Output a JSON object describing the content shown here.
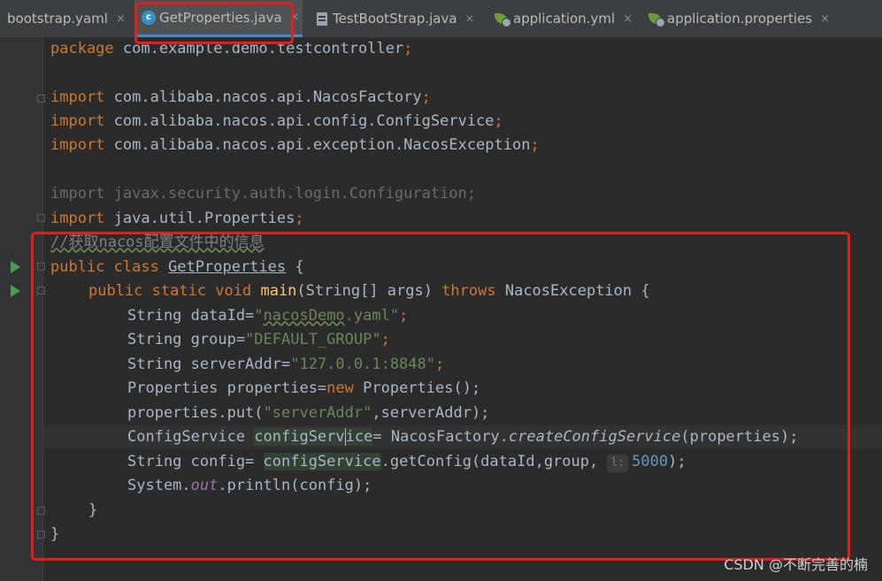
{
  "tabs": [
    {
      "label": "bootstrap.yaml",
      "icon": "yaml-file-icon"
    },
    {
      "label": "GetProperties.java",
      "icon": "java-class-icon",
      "active": true
    },
    {
      "label": "TestBootStrap.java",
      "icon": "java-file-icon"
    },
    {
      "label": "application.yml",
      "icon": "spring-config-icon"
    },
    {
      "label": "application.properties",
      "icon": "spring-config-icon"
    }
  ],
  "tab_close_glyph": "×",
  "code": {
    "package_kw": "package",
    "package_name": " com.example.demo.testcontroller",
    "semi": ";",
    "import_kw": "import",
    "imports": [
      " com.alibaba.nacos.api.NacosFactory",
      " com.alibaba.nacos.api.config.ConfigService",
      " com.alibaba.nacos.api.exception.NacosException"
    ],
    "unused_import": "import javax.security.auth.login.Configuration;",
    "import_last": " java.util.Properties",
    "comment": "//获取nacos配置文件中的信息",
    "class_decl_kw": "public class ",
    "class_name": "GetProperties",
    "brace_open": " {",
    "main_kw": "public static void ",
    "main_name": "main",
    "main_params": "(String[] args) ",
    "throws_kw": "throws",
    "main_tail": " NacosException {",
    "l1_pre": "String dataId=",
    "l1_q1": "\"",
    "l1_str": "nacosDemo",
    "l1_str2": ".yaml\"",
    "l2_pre": "String group=",
    "l2_str": "\"DEFAULT_GROUP\"",
    "l3_pre": "String serverAddr=",
    "l3_str": "\"127.0.0.1:8848\"",
    "l4_pre": "Properties properties=",
    "l4_new": "new",
    "l4_post": " Properties();",
    "l5_pre": "properties.put(",
    "l5_str": "\"serverAddr\"",
    "l5_post": ",serverAddr);",
    "l6_pre": "ConfigService ",
    "l6_var1": "configServ",
    "l6_var2": "ice",
    "l6_mid": "= NacosFactory.",
    "l6_call": "createConfigService",
    "l6_post": "(properties);",
    "l7_pre": "String config= ",
    "l7_var": "configService",
    "l7_mid": ".getConfig(dataId,group,",
    "l7_hint": "l:",
    "l7_num": "5000",
    "l7_post": ");",
    "l8_pre": "System.",
    "l8_out": "out",
    "l8_post": ".println(config);",
    "close_method": "}",
    "close_class": "}"
  },
  "watermark": "CSDN @不断完善的楠"
}
